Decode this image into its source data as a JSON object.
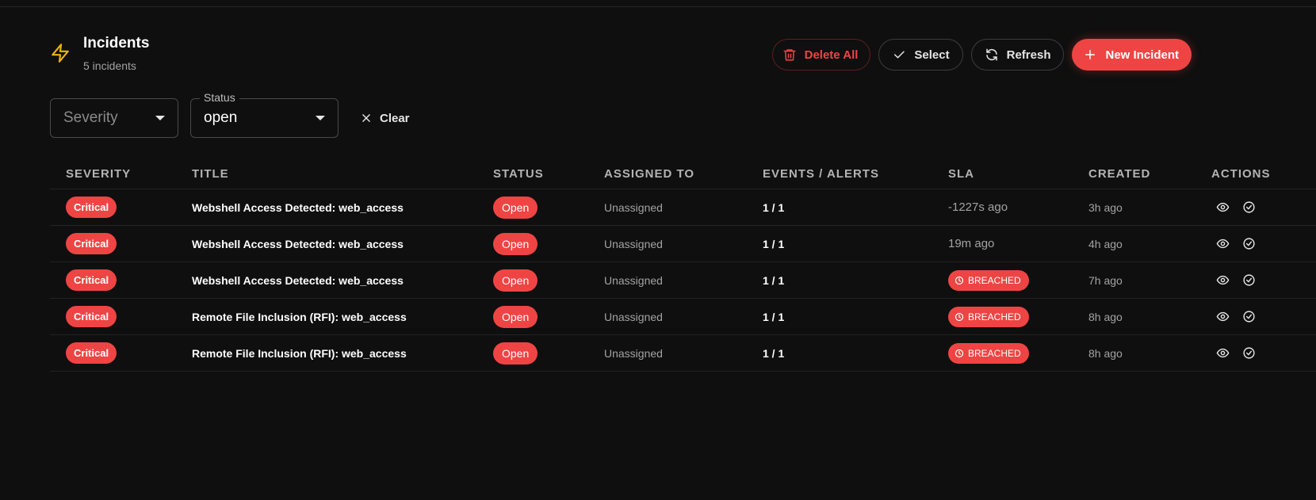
{
  "page": {
    "title": "Incidents",
    "subtitle": "5 incidents",
    "title_icon": "lightning-icon",
    "accent_color": "#ef4444",
    "icon_color": "#eab308"
  },
  "toolbar": {
    "delete_all_label": "Delete All",
    "select_label": "Select",
    "refresh_label": "Refresh",
    "new_incident_label": "New Incident"
  },
  "filters": {
    "severity_placeholder": "Severity",
    "status_label": "Status",
    "status_value": "open",
    "clear_label": "Clear"
  },
  "table": {
    "headers": {
      "severity": "Severity",
      "title": "Title",
      "status": "Status",
      "assigned": "Assigned To",
      "events": "Events / Alerts",
      "sla": "SLA",
      "created": "Created",
      "actions": "Actions"
    },
    "rows": [
      {
        "severity": "Critical",
        "title": "Webshell Access Detected: web_access",
        "status": "Open",
        "assigned": "Unassigned",
        "events": "1 / 1",
        "sla_text": "-1227s ago",
        "breached": false,
        "created": "3h ago"
      },
      {
        "severity": "Critical",
        "title": "Webshell Access Detected: web_access",
        "status": "Open",
        "assigned": "Unassigned",
        "events": "1 / 1",
        "sla_text": "19m ago",
        "breached": false,
        "created": "4h ago"
      },
      {
        "severity": "Critical",
        "title": "Webshell Access Detected: web_access",
        "status": "Open",
        "assigned": "Unassigned",
        "events": "1 / 1",
        "sla_text": "BREACHED",
        "breached": true,
        "created": "7h ago"
      },
      {
        "severity": "Critical",
        "title": "Remote File Inclusion (RFI): web_access",
        "status": "Open",
        "assigned": "Unassigned",
        "events": "1 / 1",
        "sla_text": "BREACHED",
        "breached": true,
        "created": "8h ago"
      },
      {
        "severity": "Critical",
        "title": "Remote File Inclusion (RFI): web_access",
        "status": "Open",
        "assigned": "Unassigned",
        "events": "1 / 1",
        "sla_text": "BREACHED",
        "breached": true,
        "created": "8h ago"
      }
    ]
  }
}
